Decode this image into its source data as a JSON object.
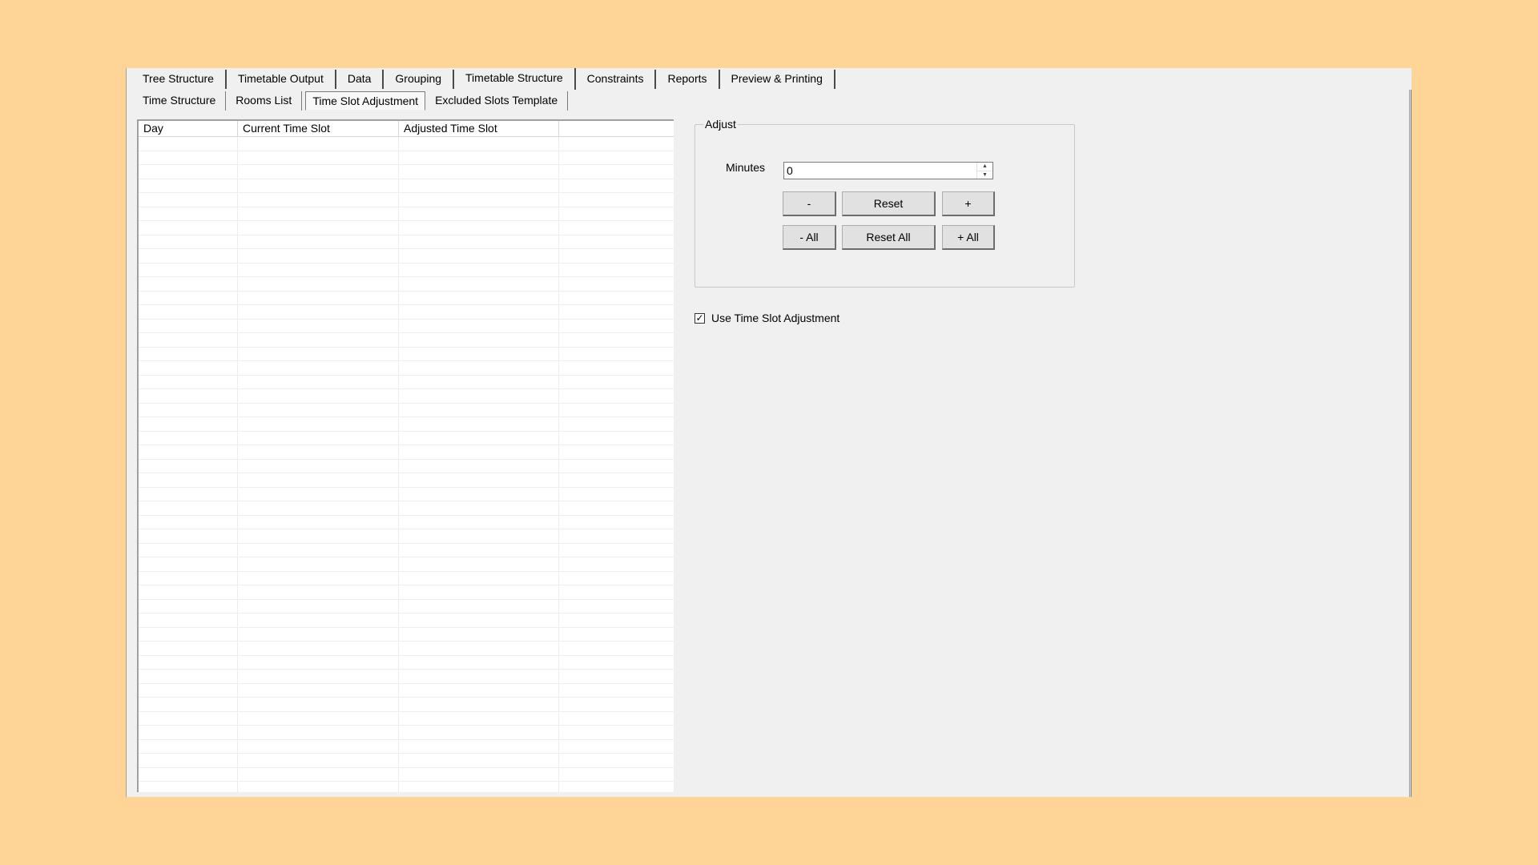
{
  "main_tabs": [
    {
      "label": "Tree Structure"
    },
    {
      "label": "Timetable Output"
    },
    {
      "label": "Data"
    },
    {
      "label": "Grouping"
    },
    {
      "label": "Timetable Structure",
      "active": true
    },
    {
      "label": "Constraints"
    },
    {
      "label": "Reports"
    },
    {
      "label": "Preview & Printing"
    }
  ],
  "sub_tabs": [
    {
      "label": "Time Structure"
    },
    {
      "label": "Rooms List"
    },
    {
      "label": "Time Slot Adjustment",
      "active": true
    },
    {
      "label": "Excluded Slots Template"
    }
  ],
  "table": {
    "columns": [
      "Day",
      "Current Time Slot",
      "Adjusted Time Slot",
      ""
    ],
    "rows": []
  },
  "adjust": {
    "title": "Adjust",
    "minutes_label": "Minutes",
    "minutes_value": "0",
    "spin_up_glyph": "▲",
    "spin_down_glyph": "▼",
    "minus_label": "-",
    "reset_label": "Reset",
    "plus_label": "+",
    "minus_all_label": "- All",
    "reset_all_label": "Reset All",
    "plus_all_label": "+ All"
  },
  "use_adjustment": {
    "label": "Use Time Slot Adjustment",
    "checked": true,
    "check_glyph": "✓"
  }
}
